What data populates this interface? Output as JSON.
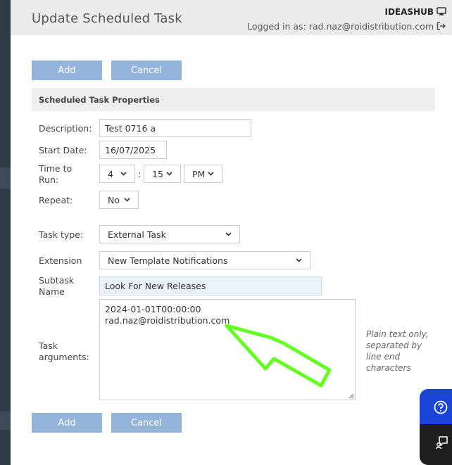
{
  "header": {
    "title": "Update Scheduled Task",
    "brand": "IDEASHUB",
    "login_text": "Logged in as: rad.naz@roidistribution.com"
  },
  "toolbar_top": {
    "add_label": "Add",
    "cancel_label": "Cancel"
  },
  "section": {
    "title": "Scheduled Task Properties"
  },
  "form": {
    "description": {
      "label": "Description:",
      "value": "Test 0716 a"
    },
    "start_date": {
      "label": "Start Date:",
      "value": "16/07/2025"
    },
    "time_to_run": {
      "label_line1": "Time to",
      "label_line2": "Run:",
      "hour": "4",
      "minute": "15",
      "ampm": "PM",
      "separator": ":"
    },
    "repeat": {
      "label": "Repeat:",
      "value": "No"
    },
    "task_type": {
      "label": "Task type:",
      "value": "External Task"
    },
    "extension": {
      "label": "Extension",
      "value": "New Template Notifications"
    },
    "subtask_name": {
      "label_line1": "Subtask",
      "label_line2": "Name",
      "value": "Look For New Releases"
    },
    "task_arguments": {
      "label_line1": "Task",
      "label_line2": "arguments:",
      "lines": [
        "2024-01-01T00:00:00",
        "rad.naz@roidistribution.com"
      ],
      "helper_lines": [
        "Plain text only,",
        "separated by",
        "line end",
        "characters"
      ]
    }
  },
  "toolbar_bottom": {
    "add_label": "Add",
    "cancel_label": "Cancel"
  },
  "colors": {
    "button": "#94b4dc",
    "header_bg": "#ececec",
    "sidebar": "#2f3b47",
    "annotation_arrow": "#66ff22",
    "help_fab": "#1a44d8",
    "chat_fab": "#1e1e1e"
  },
  "icons": {
    "brand": "monitor-icon",
    "logout": "logout-icon",
    "help": "question-circle-icon",
    "chat": "chat-icon",
    "annotation": "arrow-pointer-icon"
  }
}
